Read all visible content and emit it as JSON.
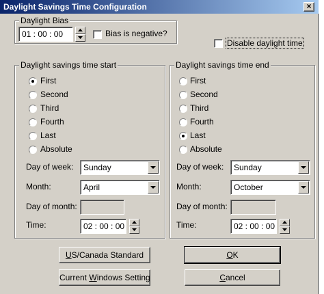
{
  "window": {
    "title": "Daylight Savings Time Configuration",
    "close_label": "×"
  },
  "bias": {
    "group_label": "Daylight Bias",
    "value": "01 : 00 : 00",
    "negative_label": "Bias is negative?",
    "negative_checked": false
  },
  "disable_daylight": {
    "label": "Disable daylight time",
    "checked": false
  },
  "start": {
    "group_label": "Daylight savings time start",
    "options": [
      "First",
      "Second",
      "Third",
      "Fourth",
      "Last",
      "Absolute"
    ],
    "selected": "First",
    "day_of_week_label": "Day of week:",
    "day_of_week": "Sunday",
    "month_label": "Month:",
    "month": "April",
    "day_of_month_label": "Day of month:",
    "day_of_month": "",
    "time_label": "Time:",
    "time": "02 : 00 : 00"
  },
  "end": {
    "group_label": "Daylight savings time end",
    "options": [
      "First",
      "Second",
      "Third",
      "Fourth",
      "Last",
      "Absolute"
    ],
    "selected": "Last",
    "day_of_week_label": "Day of week:",
    "day_of_week": "Sunday",
    "month_label": "Month:",
    "month": "October",
    "day_of_month_label": "Day of month:",
    "day_of_month": "",
    "time_label": "Time:",
    "time": "02 : 00 : 00"
  },
  "buttons": {
    "us_canada_pre": "",
    "us_canada_key": "U",
    "us_canada_post": "S/Canada Standard",
    "current_pre": "Current ",
    "current_key": "W",
    "current_post": "indows Setting",
    "ok_key": "O",
    "ok_post": "K",
    "cancel_key": "C",
    "cancel_post": "ancel"
  },
  "colors": {
    "dialog_face": "#d4d0c8",
    "title_start": "#0a246a",
    "title_end": "#a6caf0"
  }
}
